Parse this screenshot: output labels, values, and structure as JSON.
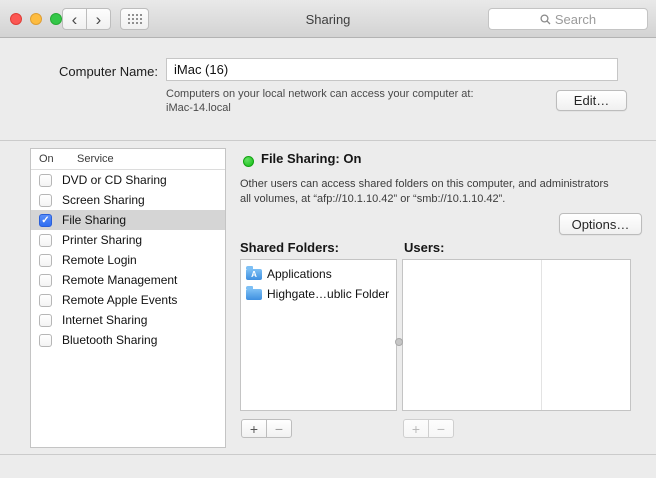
{
  "colors": {
    "accent_blue": "#2f6ef2",
    "status_green": "#14bd14",
    "selection_gray": "#d5d5d5"
  },
  "titlebar": {
    "title": "Sharing",
    "back_glyph": "‹",
    "forward_glyph": "›",
    "search_placeholder": "Search"
  },
  "header": {
    "computer_name_label": "Computer Name:",
    "computer_name_value": "iMac (16)",
    "access_note_line1": "Computers on your local network can access your computer at:",
    "access_note_line2": "iMac-14.local",
    "edit_button": "Edit…"
  },
  "services": {
    "columns": {
      "on": "On",
      "service": "Service"
    },
    "items": [
      {
        "label": "DVD or CD Sharing",
        "checked": false,
        "selected": false
      },
      {
        "label": "Screen Sharing",
        "checked": false,
        "selected": false
      },
      {
        "label": "File Sharing",
        "checked": true,
        "selected": true
      },
      {
        "label": "Printer Sharing",
        "checked": false,
        "selected": false
      },
      {
        "label": "Remote Login",
        "checked": false,
        "selected": false
      },
      {
        "label": "Remote Management",
        "checked": false,
        "selected": false
      },
      {
        "label": "Remote Apple Events",
        "checked": false,
        "selected": false
      },
      {
        "label": "Internet Sharing",
        "checked": false,
        "selected": false
      },
      {
        "label": "Bluetooth Sharing",
        "checked": false,
        "selected": false
      }
    ]
  },
  "detail": {
    "status_title": "File Sharing: On",
    "description_line1": "Other users can access shared folders on this computer, and administrators",
    "description_line2": "all volumes, at “afp://10.1.10.42” or “smb://10.1.10.42”.",
    "options_button": "Options…",
    "shared_folders_label": "Shared Folders:",
    "users_label": "Users:",
    "shared_folders": [
      {
        "name": "Applications",
        "icon": "applications-folder-icon",
        "badge": "A"
      },
      {
        "name": "Highgate…ublic Folder",
        "icon": "public-folder-icon",
        "badge": ""
      }
    ],
    "users": [],
    "add_label": "+",
    "remove_label": "−"
  }
}
